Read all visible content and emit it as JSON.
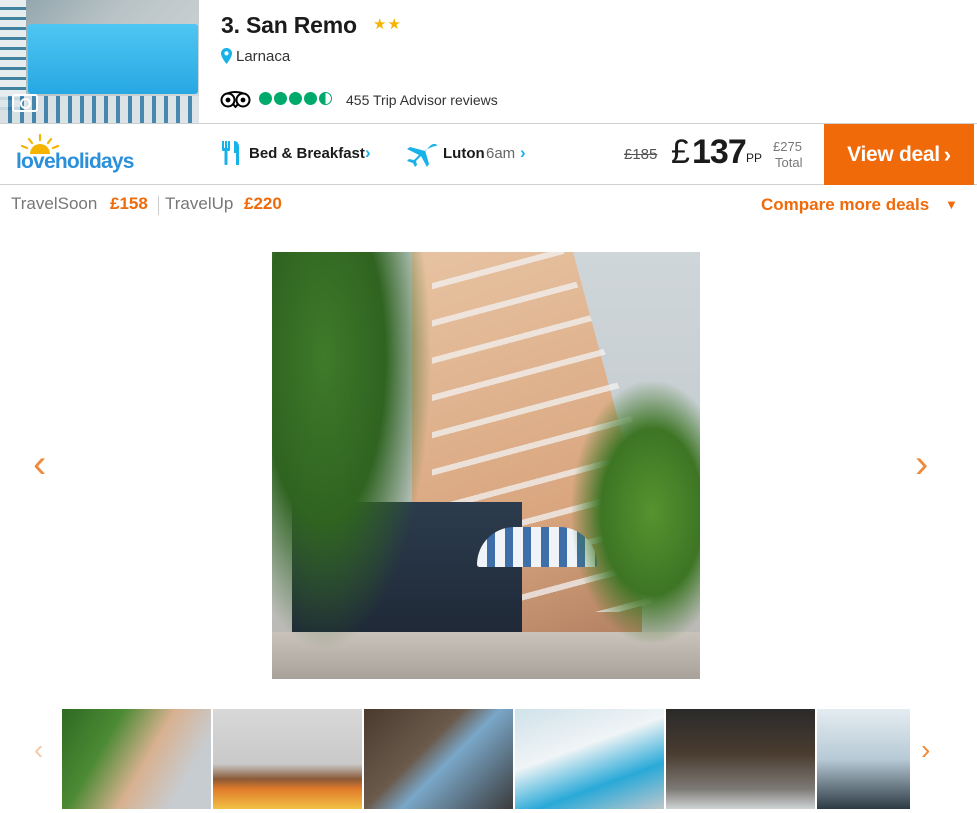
{
  "hotel": {
    "title": "3. San Remo",
    "stars": "★★",
    "location": "Larnaca",
    "reviews": "455 Trip Advisor reviews",
    "rating_bubbles": 4.5
  },
  "deal": {
    "provider_logo": "loveholidays",
    "board": "Bed & Breakfast",
    "flight_airport": "Luton",
    "flight_time": "6am",
    "old_price": "£185",
    "currency": "£",
    "price": "137",
    "price_unit": "PP",
    "total_amount": "£275",
    "total_label": "Total",
    "cta": "View deal",
    "chevron": "›"
  },
  "alt_deals": {
    "travelsoon_label": "TravelSoon",
    "travelsoon_price": "£158",
    "travelup_label": "TravelUp",
    "travelup_price": "£220",
    "compare": "Compare more deals",
    "caret": "▼"
  },
  "gallery": {
    "prev": "‹",
    "next": "›",
    "thumb_prev": "‹",
    "thumb_next": "›"
  },
  "icons": {
    "location": "map-pin-icon",
    "tripadvisor": "tripadvisor-owl-icon",
    "board": "cutlery-icon",
    "flight": "plane-icon",
    "camera": "camera-icon"
  },
  "colors": {
    "accent": "#f06a0a",
    "link": "#16b2e8",
    "tripadvisor": "#00aa6c",
    "star": "#f5b400",
    "logo": "#2b90d9"
  }
}
